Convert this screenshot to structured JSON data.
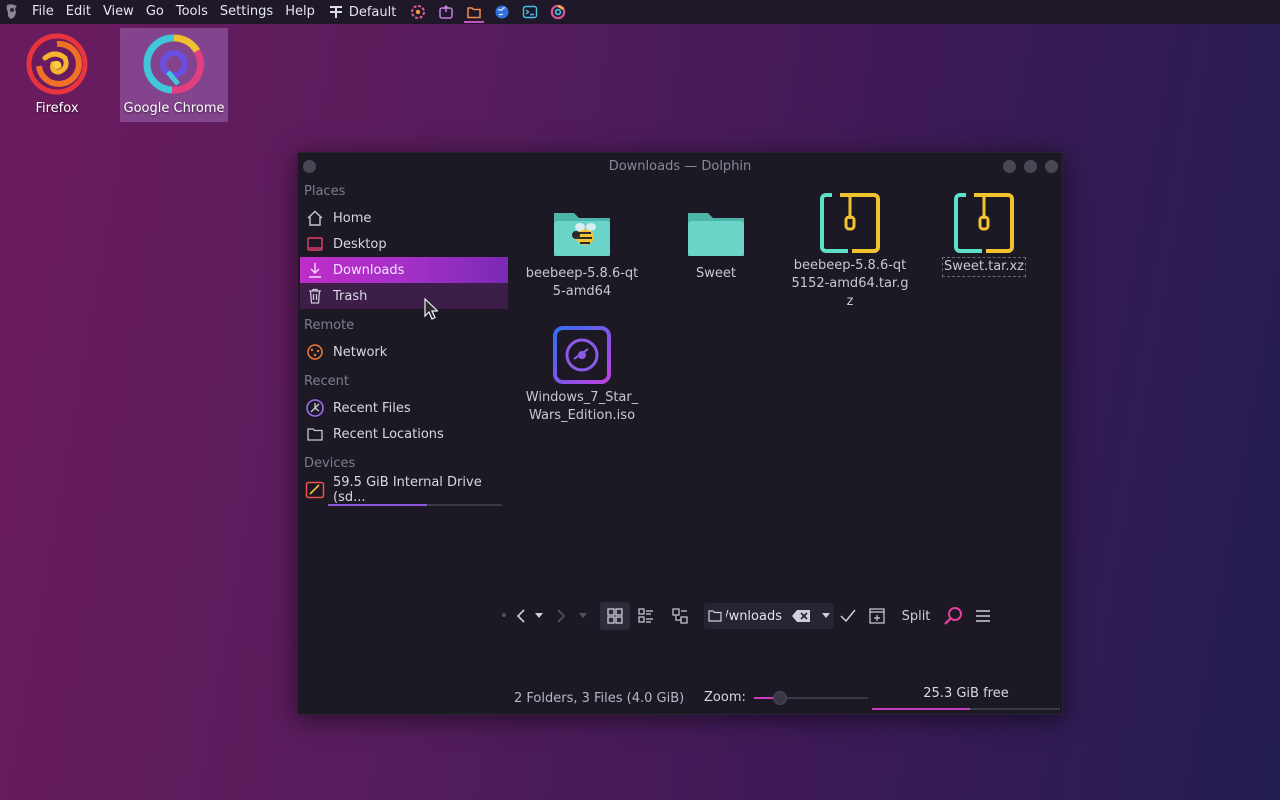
{
  "menubar": {
    "items": [
      "File",
      "Edit",
      "View",
      "Go",
      "Tools",
      "Settings",
      "Help"
    ],
    "layout_label": "Default",
    "tray_icons": [
      "settings-icon",
      "screenshot-icon",
      "folder-icon",
      "globe-icon",
      "terminal-icon",
      "chrome-icon"
    ]
  },
  "desktop": {
    "icons": [
      {
        "label": "Firefox",
        "icon": "firefox-icon",
        "selected": false
      },
      {
        "label": "Google Chrome",
        "icon": "chrome-icon",
        "selected": true
      }
    ]
  },
  "window": {
    "title": "Downloads — Dolphin",
    "sidebar": {
      "places_header": "Places",
      "places": [
        "Home",
        "Desktop",
        "Downloads",
        "Trash"
      ],
      "active_place": "Downloads",
      "remote_header": "Remote",
      "remote": [
        "Network"
      ],
      "recent_header": "Recent",
      "recent": [
        "Recent Files",
        "Recent Locations"
      ],
      "devices_header": "Devices",
      "devices": [
        {
          "label": "59.5 GiB Internal Drive (sd...",
          "usage_fraction": 0.57
        }
      ]
    },
    "files": [
      {
        "name": "beebeep-5.8.6-qt5-amd64",
        "type": "folder-bee"
      },
      {
        "name": "Sweet",
        "type": "folder"
      },
      {
        "name": "beebeep-5.8.6-qt5152-amd64.tar.gz",
        "type": "archive"
      },
      {
        "name": "Sweet.tar.xz",
        "type": "archive"
      },
      {
        "name": "Windows_7_Star_Wars_Edition.iso",
        "type": "disc-image"
      }
    ],
    "toolbar": {
      "path": "wnloads/",
      "split_label": "Split"
    },
    "status": {
      "summary": "2 Folders, 3 Files (4.0 GiB)",
      "zoom_label": "Zoom:",
      "zoom_fraction": 0.22,
      "free_label": "25.3 GiB free",
      "used_fraction": 0.52
    }
  },
  "colors": {
    "accent": "#c02cc8",
    "window_bg": "#1c1925",
    "folder_teal": "#5ecdc2",
    "archive_yellow": "#f0c030"
  }
}
